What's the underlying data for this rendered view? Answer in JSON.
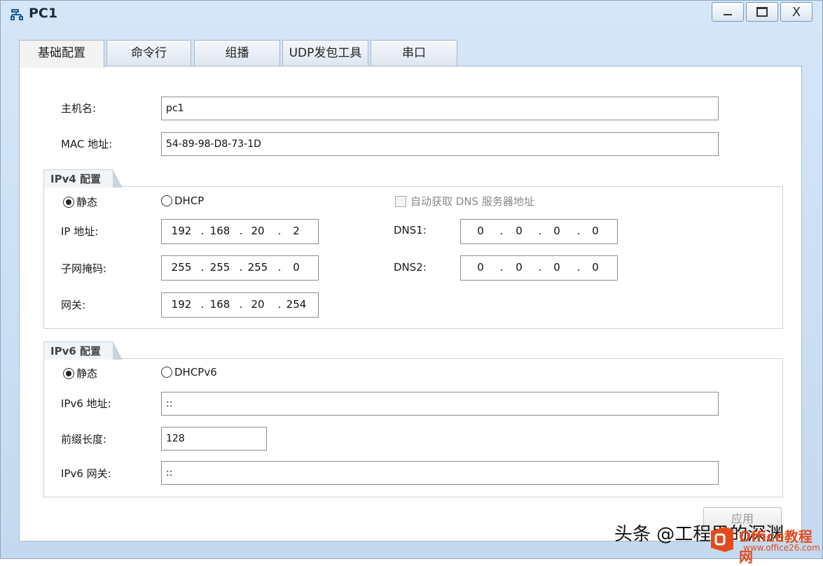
{
  "window": {
    "title": "PC1",
    "controls": {
      "minimize": "minimize",
      "maximize": "maximize",
      "close": "X"
    }
  },
  "tabs": [
    {
      "label": "基础配置",
      "active": true
    },
    {
      "label": "命令行",
      "active": false
    },
    {
      "label": "组播",
      "active": false
    },
    {
      "label": "UDP发包工具",
      "active": false
    },
    {
      "label": "串口",
      "active": false
    }
  ],
  "basic": {
    "hostname_label": "主机名:",
    "hostname_value": "pc1",
    "mac_label": "MAC 地址:",
    "mac_value": "54-89-98-D8-73-1D"
  },
  "ipv4": {
    "group_title": "IPv4 配置",
    "static_label": "静态",
    "dhcp_label": "DHCP",
    "auto_dns_label": "自动获取 DNS 服务器地址",
    "ip_label": "IP 地址:",
    "ip": [
      "192",
      "168",
      "20",
      "2"
    ],
    "mask_label": "子网掩码:",
    "mask": [
      "255",
      "255",
      "255",
      "0"
    ],
    "gateway_label": "网关:",
    "gateway": [
      "192",
      "168",
      "20",
      "254"
    ],
    "dns1_label": "DNS1:",
    "dns1": [
      "0",
      "0",
      "0",
      "0"
    ],
    "dns2_label": "DNS2:",
    "dns2": [
      "0",
      "0",
      "0",
      "0"
    ]
  },
  "ipv6": {
    "group_title": "IPv6 配置",
    "static_label": "静态",
    "dhcp_label": "DHCPv6",
    "addr_label": "IPv6 地址:",
    "addr_value": "::",
    "prefix_label": "前缀长度:",
    "prefix_value": "128",
    "gateway_label": "IPv6 网关:",
    "gateway_value": "::"
  },
  "apply_label": "应用",
  "watermark": {
    "text": "头条 @工程男的深渊",
    "brand": "Office教程网",
    "brand_url": "www.office26.com"
  },
  "colors": {
    "window_bg": "#c4d9ef",
    "watermark_brand": "#e34a1b"
  }
}
